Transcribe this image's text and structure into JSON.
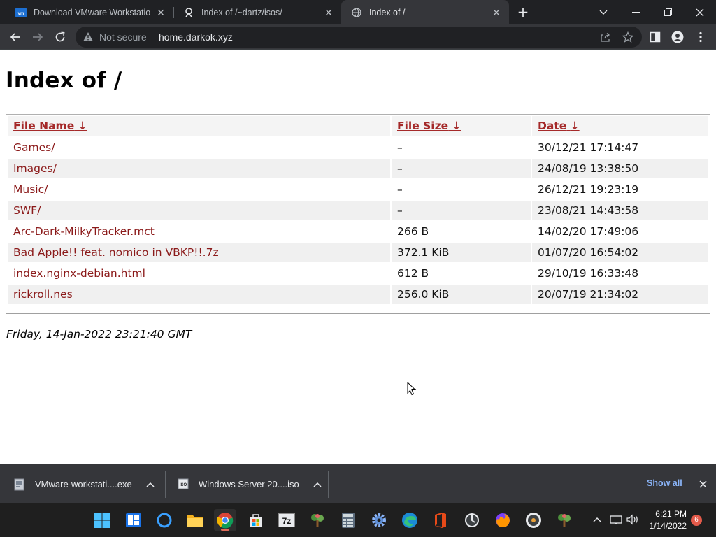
{
  "browser": {
    "tabs": [
      {
        "title": "Download VMware Workstation P",
        "favicon": "vmware-icon",
        "active": false
      },
      {
        "title": "Index of /~dartz/isos/",
        "favicon": "site-icon",
        "active": false
      },
      {
        "title": "Index of /",
        "favicon": "globe-icon",
        "active": true
      }
    ],
    "security_label": "Not secure",
    "url": "home.darkok.xyz"
  },
  "page": {
    "heading": "Index of /",
    "columns": {
      "name": "File Name",
      "size": "File Size",
      "date": "Date",
      "sort_indicator": "↓"
    },
    "rows": [
      {
        "name": "Games/",
        "size": "–",
        "date": "30/12/21 17:14:47"
      },
      {
        "name": "Images/",
        "size": "–",
        "date": "24/08/19 13:38:50"
      },
      {
        "name": "Music/",
        "size": "–",
        "date": "26/12/21 19:23:19"
      },
      {
        "name": "SWF/",
        "size": "–",
        "date": "23/08/21 14:43:58"
      },
      {
        "name": "Arc-Dark-MilkyTracker.mct",
        "size": "266 B",
        "date": "14/02/20 17:49:06"
      },
      {
        "name": "Bad Apple!! feat. nomico in VBKP!!.7z",
        "size": "372.1 KiB",
        "date": "01/07/20 16:54:02"
      },
      {
        "name": "index.nginx-debian.html",
        "size": "612 B",
        "date": "29/10/19 16:33:48"
      },
      {
        "name": "rickroll.nes",
        "size": "256.0 KiB",
        "date": "20/07/19 21:34:02"
      }
    ],
    "footer_date": "Friday, 14-Jan-2022 23:21:40 GMT"
  },
  "downloads": {
    "items": [
      {
        "filename": "VMware-workstati....exe",
        "icon": "file-exe-icon"
      },
      {
        "filename": "Windows Server 20....iso",
        "icon": "file-iso-icon"
      }
    ],
    "show_all_label": "Show all"
  },
  "taskbar": {
    "apps": [
      "start",
      "widgets",
      "cortana",
      "file-explorer",
      "chrome",
      "store",
      "7zip",
      "app-tree",
      "calculator",
      "settings",
      "edge",
      "office",
      "clock-app",
      "firefox",
      "media",
      "app-tree-2"
    ],
    "time": "6:21 PM",
    "date": "1/14/2022",
    "notification_count": "6"
  },
  "colors": {
    "tab_strip": "#202124",
    "toolbar": "#35363a",
    "link": "#8b1a1a",
    "header_link": "#a52a2a",
    "show_all": "#8ab4f8",
    "taskbar": "#1f1f1f"
  }
}
